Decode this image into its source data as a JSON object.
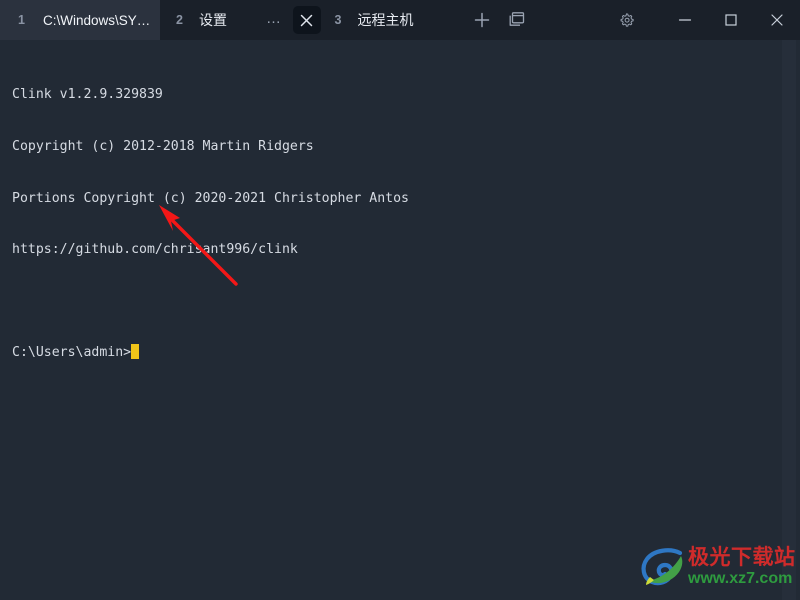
{
  "window": {
    "app_background": "#222a35",
    "titlebar_background": "#1a2029",
    "active_tab_background": "#2b323e"
  },
  "tabbar": {
    "tabs": [
      {
        "index": "1",
        "title": "C:\\Windows\\SY…",
        "active": true
      },
      {
        "index": "2",
        "title": "设置",
        "active": false
      },
      {
        "index": "3",
        "title": "远程主机",
        "active": false
      }
    ],
    "overflow_label": "…",
    "close_tab_icon": "close-icon",
    "new_tab_icon": "plus-icon",
    "split_pane_icon": "panes-icon"
  },
  "window_controls": {
    "settings_icon": "gear-icon",
    "minimize_icon": "minimize-icon",
    "maximize_icon": "maximize-icon",
    "close_icon": "close-icon"
  },
  "terminal": {
    "lines": [
      "Clink v1.2.9.329839",
      "Copyright (c) 2012-2018 Martin Ridgers",
      "Portions Copyright (c) 2020-2021 Christopher Antos",
      "https://github.com/chrisant996/clink",
      ""
    ],
    "prompt": "C:\\Users\\admin>",
    "cursor_color": "#f0c419",
    "text_color": "#d6dbe3"
  },
  "annotation": {
    "arrow_color": "#f41717",
    "arrow_name": "red-pointer-arrow"
  },
  "watermark": {
    "title": "极光下载站",
    "url": "www.xz7.com",
    "title_color": "#cf2b2b",
    "url_color": "#2e9b3f"
  }
}
